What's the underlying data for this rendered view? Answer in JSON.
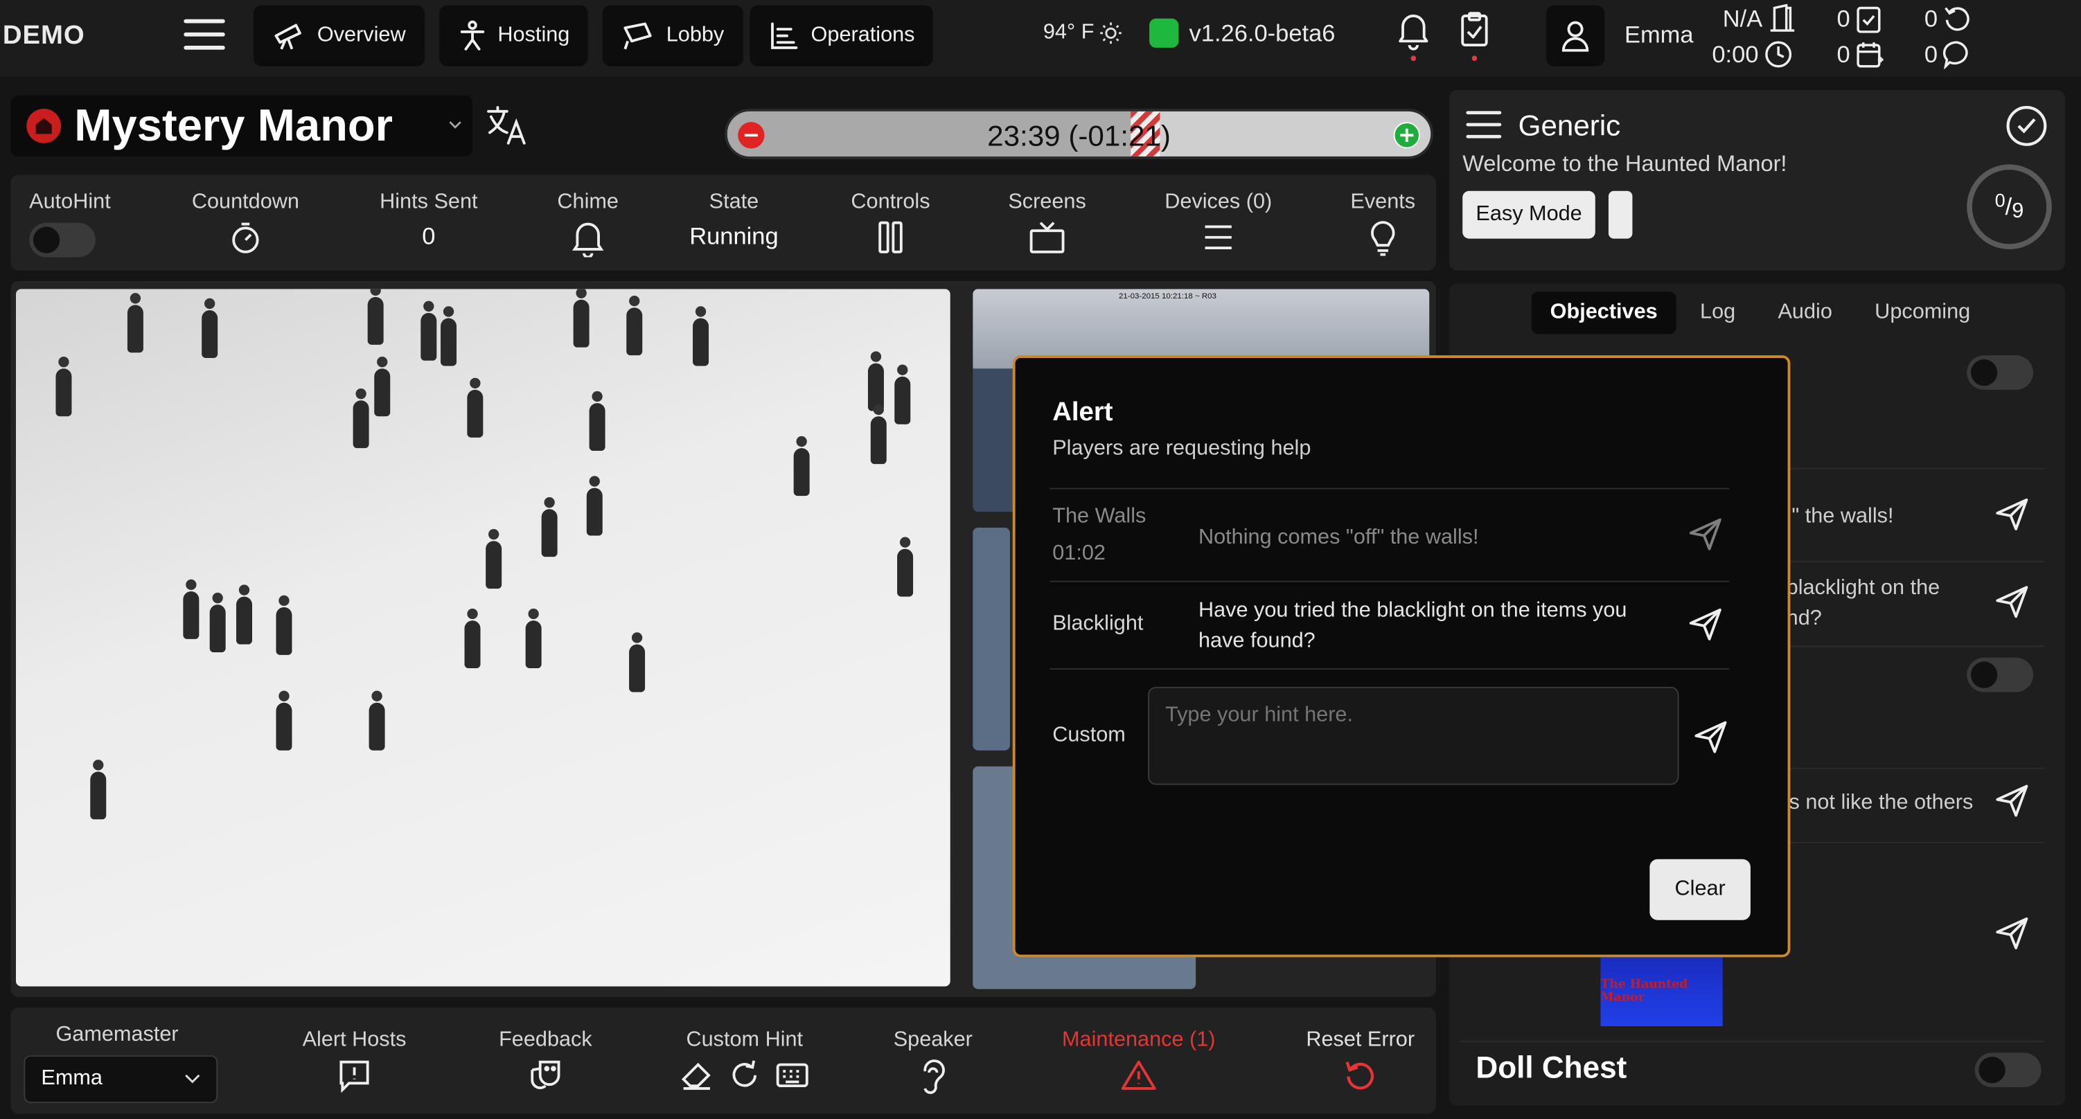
{
  "topbar": {
    "brand": "DEMO",
    "nav": [
      "Overview",
      "Hosting",
      "Lobby",
      "Operations"
    ],
    "temperature": "94° F",
    "version": "v1.26.0-beta6",
    "user": "Emma",
    "stats": {
      "na": "N/A",
      "time": "0:00",
      "checklist_count": "0",
      "calendar_count": "0",
      "reset_count": "0",
      "chat_count": "0"
    }
  },
  "game": {
    "title": "Mystery Manor",
    "timer_text": "23:39 (-01:21)",
    "timer_progress": 0.58
  },
  "controls": {
    "autohint_label": "AutoHint",
    "countdown_label": "Countdown",
    "hints_sent_label": "Hints Sent",
    "hints_sent_value": "0",
    "chime_label": "Chime",
    "state_label": "State",
    "state_value": "Running",
    "controls_label": "Controls",
    "screens_label": "Screens",
    "devices_label": "Devices (0)",
    "events_label": "Events"
  },
  "camera": {
    "overlay_text": "21-03-2015 10:21:18 ~ R03"
  },
  "alert": {
    "title": "Alert",
    "subtitle": "Players are requesting help",
    "hints": [
      {
        "label": "The Walls",
        "time": "01:02",
        "text": "Nothing comes \"off\" the walls!"
      },
      {
        "label": "Blacklight",
        "text": "Have you tried the blacklight on the items you have found?"
      }
    ],
    "custom_label": "Custom",
    "custom_placeholder": "Type your hint here.",
    "clear_label": "Clear"
  },
  "sidepanel": {
    "title": "Generic",
    "welcome": "Welcome to the Haunted Manor!",
    "easy_mode": "Easy Mode",
    "progress_num": "0",
    "progress_den": "9",
    "tabs": [
      "Objectives",
      "Log",
      "Audio",
      "Upcoming"
    ],
    "row_texts": [
      "\" the walls!",
      "blacklight on the",
      "nd?",
      "s not like the others"
    ],
    "poster_text": "The Haunted Manor",
    "doll_chest": "Doll Chest"
  },
  "bottombar": {
    "gamemaster_label": "Gamemaster",
    "gamemaster_value": "Emma",
    "alert_hosts": "Alert Hosts",
    "feedback": "Feedback",
    "custom_hint": "Custom Hint",
    "speaker": "Speaker",
    "maintenance": "Maintenance (1)",
    "reset_error": "Reset Error",
    "maintenance_color": "#e53535",
    "reset_color": "#e53535"
  }
}
